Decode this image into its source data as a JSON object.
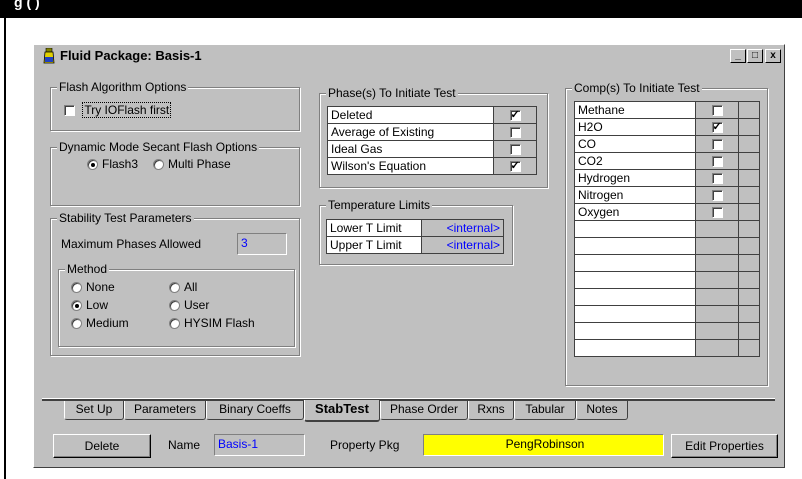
{
  "top_strip": {
    "text": "g ( )"
  },
  "window": {
    "title": "Fluid Package: Basis-1",
    "controls": [
      "_",
      "□",
      "x"
    ]
  },
  "flash": {
    "legend": "Flash Algorithm Options",
    "try_label": "Try IOFlash first",
    "try_checked": false
  },
  "dynamic": {
    "legend": "Dynamic Mode Secant Flash Options",
    "options": [
      "Flash3",
      "Multi Phase"
    ],
    "selected": "Flash3"
  },
  "stability": {
    "legend": "Stability Test Parameters",
    "max_label": "Maximum Phases Allowed",
    "max_value": "3",
    "method_legend": "Method",
    "methods": [
      "None",
      "All",
      "Low",
      "User",
      "Medium",
      "HYSIM Flash"
    ],
    "selected": "Low"
  },
  "phases": {
    "legend": "Phase(s) To Initiate Test",
    "rows": [
      {
        "label": "Deleted",
        "checked": true
      },
      {
        "label": "Average of Existing",
        "checked": false
      },
      {
        "label": "Ideal Gas",
        "checked": false
      },
      {
        "label": "Wilson's Equation",
        "checked": true
      }
    ]
  },
  "temperature": {
    "legend": "Temperature Limits",
    "rows": [
      {
        "label": "Lower T Limit",
        "value": "<internal>"
      },
      {
        "label": "Upper T Limit",
        "value": "<internal>"
      }
    ]
  },
  "comps": {
    "legend": "Comp(s) To Initiate Test",
    "rows": [
      {
        "label": "Methane",
        "checked": false
      },
      {
        "label": "H2O",
        "checked": true
      },
      {
        "label": "CO",
        "checked": false
      },
      {
        "label": "CO2",
        "checked": false
      },
      {
        "label": "Hydrogen",
        "checked": false
      },
      {
        "label": "Nitrogen",
        "checked": false
      },
      {
        "label": "Oxygen",
        "checked": false
      }
    ],
    "empty_rows": 8
  },
  "tabs": [
    "Set Up",
    "Parameters",
    "Binary Coeffs",
    "StabTest",
    "Phase Order",
    "Rxns",
    "Tabular",
    "Notes"
  ],
  "active_tab": "StabTest",
  "footer": {
    "delete_label": "Delete",
    "name_label": "Name",
    "name_value": "Basis-1",
    "pkg_label": "Property Pkg",
    "pkg_value": "PengRobinson",
    "edit_label": "Edit Properties"
  },
  "colors": {
    "face": "#c0c0c0",
    "highlight": "#ffff00",
    "value_text": "#0000ff"
  }
}
